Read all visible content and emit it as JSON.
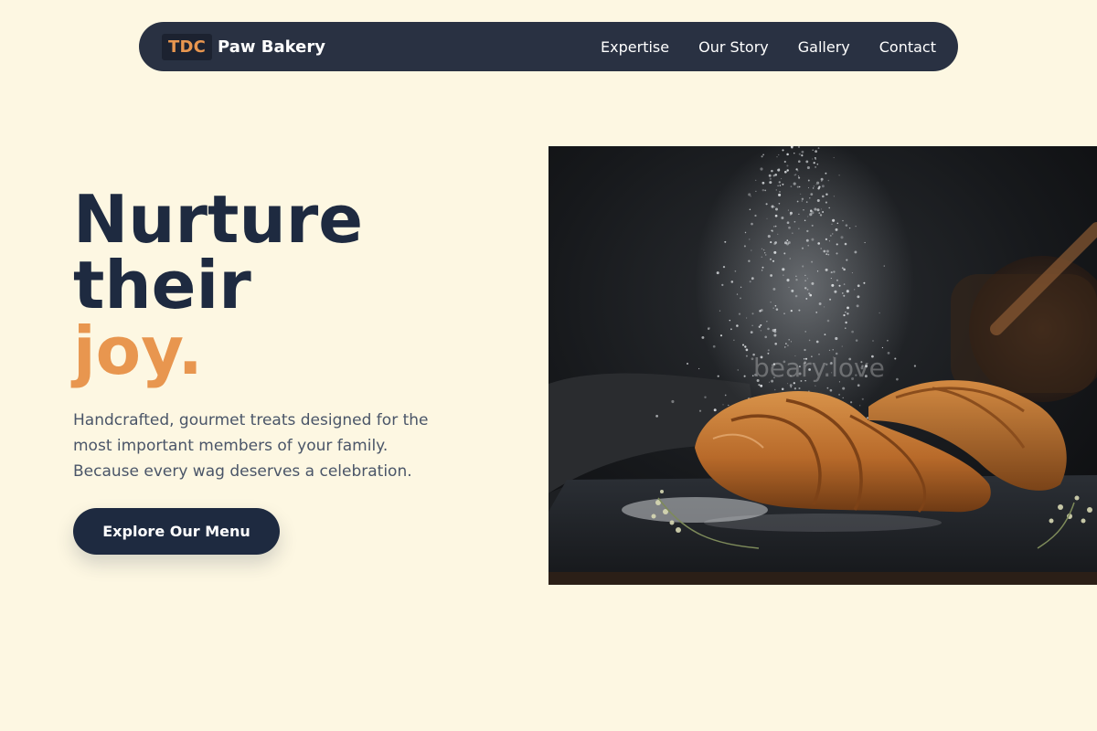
{
  "nav": {
    "logo_badge": "TDC",
    "brand_name": "Paw Bakery",
    "links": [
      "Expertise",
      "Our Story",
      "Gallery",
      "Contact"
    ]
  },
  "hero": {
    "headline_line1": "Nurture",
    "headline_line2": "their",
    "headline_accent": "joy.",
    "subtext_lines": [
      "Handcrafted, gourmet treats designed for the",
      "most important members of your family.",
      "Because every wag deserves a celebration."
    ],
    "cta_label": "Explore Our Menu"
  },
  "image": {
    "watermark": "beary.love"
  },
  "colors": {
    "background": "#fdf7e2",
    "nav": "#293142",
    "primary": "#1e2a40",
    "accent": "#e8964f",
    "body_text": "#4a5568"
  }
}
